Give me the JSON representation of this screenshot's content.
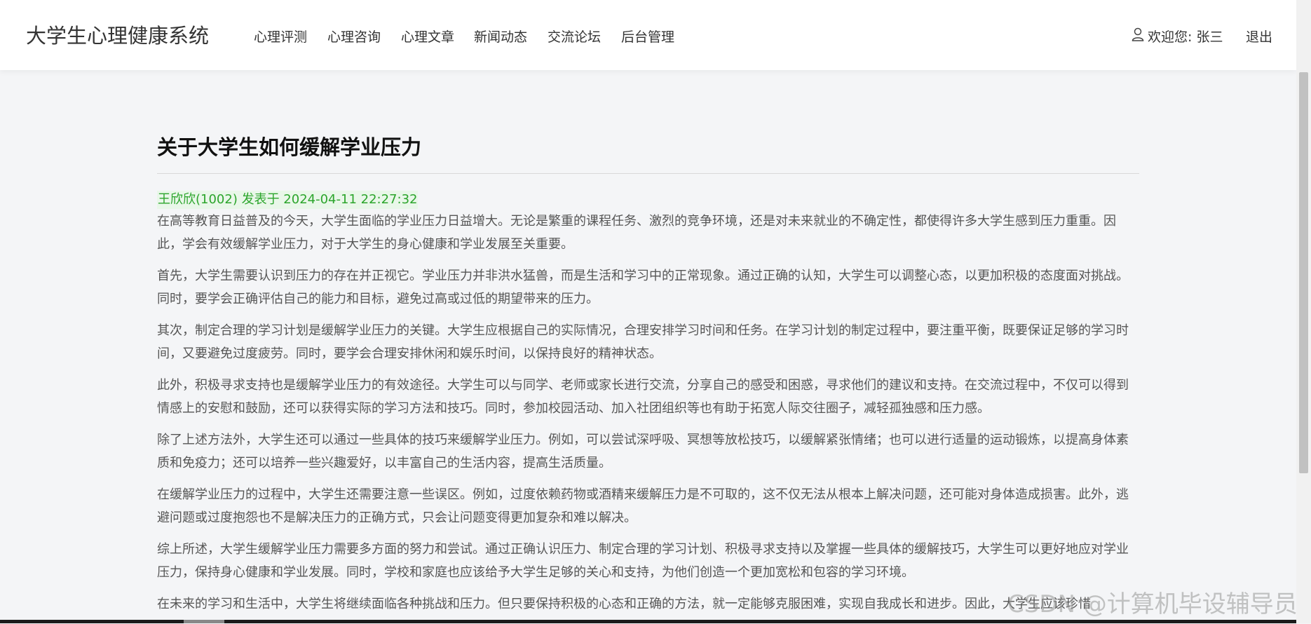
{
  "header": {
    "brand": "大学生心理健康系统",
    "nav": [
      {
        "label": "心理评测"
      },
      {
        "label": "心理咨询"
      },
      {
        "label": "心理文章"
      },
      {
        "label": "新闻动态"
      },
      {
        "label": "交流论坛"
      },
      {
        "label": "后台管理"
      }
    ],
    "welcome": "欢迎您: 张三",
    "logout": "退出"
  },
  "article": {
    "title": "关于大学生如何缓解学业压力",
    "meta": "王欣欣(1002) 发表于 2024-04-11 22:27:32",
    "paragraphs": [
      "在高等教育日益普及的今天，大学生面临的学业压力日益增大。无论是繁重的课程任务、激烈的竞争环境，还是对未来就业的不确定性，都使得许多大学生感到压力重重。因此，学会有效缓解学业压力，对于大学生的身心健康和学业发展至关重要。",
      "首先，大学生需要认识到压力的存在并正视它。学业压力并非洪水猛兽，而是生活和学习中的正常现象。通过正确的认知，大学生可以调整心态，以更加积极的态度面对挑战。同时，要学会正确评估自己的能力和目标，避免过高或过低的期望带来的压力。",
      "其次，制定合理的学习计划是缓解学业压力的关键。大学生应根据自己的实际情况，合理安排学习时间和任务。在学习计划的制定过程中，要注重平衡，既要保证足够的学习时间，又要避免过度疲劳。同时，要学会合理安排休闲和娱乐时间，以保持良好的精神状态。",
      "此外，积极寻求支持也是缓解学业压力的有效途径。大学生可以与同学、老师或家长进行交流，分享自己的感受和困惑，寻求他们的建议和支持。在交流过程中，不仅可以得到情感上的安慰和鼓励，还可以获得实际的学习方法和技巧。同时，参加校园活动、加入社团组织等也有助于拓宽人际交往圈子，减轻孤独感和压力感。",
      "除了上述方法外，大学生还可以通过一些具体的技巧来缓解学业压力。例如，可以尝试深呼吸、冥想等放松技巧，以缓解紧张情绪；也可以进行适量的运动锻炼，以提高身体素质和免疫力；还可以培养一些兴趣爱好，以丰富自己的生活内容，提高生活质量。",
      "在缓解学业压力的过程中，大学生还需要注意一些误区。例如，过度依赖药物或酒精来缓解压力是不可取的，这不仅无法从根本上解决问题，还可能对身体造成损害。此外，逃避问题或过度抱怨也不是解决压力的正确方式，只会让问题变得更加复杂和难以解决。",
      "综上所述，大学生缓解学业压力需要多方面的努力和尝试。通过正确认识压力、制定合理的学习计划、积极寻求支持以及掌握一些具体的缓解技巧，大学生可以更好地应对学业压力，保持身心健康和学业发展。同时，学校和家庭也应该给予大学生足够的关心和支持，为他们创造一个更加宽松和包容的学习环境。",
      "在未来的学习和生活中，大学生将继续面临各种挑战和压力。但只要保持积极的心态和正确的方法，就一定能够克服困难，实现自我成长和进步。因此，大学生应该珍惜"
    ]
  },
  "watermark": "CSDN @计算机毕设辅导员"
}
